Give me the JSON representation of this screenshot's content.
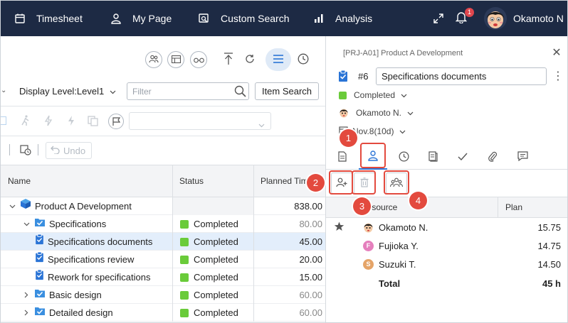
{
  "nav": {
    "items": [
      {
        "label": "Timesheet",
        "icon": "calendar-icon"
      },
      {
        "label": "My Page",
        "icon": "person-icon"
      },
      {
        "label": "Custom Search",
        "icon": "search-screen-icon"
      },
      {
        "label": "Analysis",
        "icon": "bar-chart-icon"
      }
    ],
    "notification_count": "1",
    "user_name": "Okamoto N"
  },
  "left": {
    "display_level": "Display Level:Level1",
    "filter_placeholder": "Filter",
    "item_search_label": "Item Search",
    "undo_label": "Undo",
    "columns": {
      "name": "Name",
      "status": "Status",
      "planned": "Planned Tim"
    },
    "rows": [
      {
        "name": "Product A Development",
        "status": "",
        "planned": "838.00",
        "expander": "expanded",
        "kind": "project"
      },
      {
        "name": "Specifications",
        "status": "Completed",
        "planned": "80.00",
        "expander": "expanded",
        "kind": "folder"
      },
      {
        "name": "Specifications documents",
        "status": "Completed",
        "planned": "45.00",
        "expander": "none",
        "kind": "task",
        "selected": true
      },
      {
        "name": "Specifications review",
        "status": "Completed",
        "planned": "20.00",
        "expander": "none",
        "kind": "task"
      },
      {
        "name": "Rework for specifications",
        "status": "Completed",
        "planned": "15.00",
        "expander": "none",
        "kind": "task"
      },
      {
        "name": "Basic design",
        "status": "Completed",
        "planned": "60.00",
        "expander": "collapsed",
        "kind": "folder"
      },
      {
        "name": "Detailed design",
        "status": "Completed",
        "planned": "60.00",
        "expander": "collapsed",
        "kind": "folder"
      }
    ],
    "status_color": "#6acb3a"
  },
  "detail": {
    "breadcrumb": "[PRJ-A01] Product A Development",
    "task_number": "#6",
    "task_title": "Specifications documents",
    "status": "Completed",
    "assignee": "Okamoto N.",
    "due": "Nov.8(10d)",
    "resource_header": "Resource",
    "plan_header": "Plan",
    "resources": [
      {
        "name": "Okamoto N.",
        "plan": "15.75",
        "avatar": "face",
        "starred": true
      },
      {
        "name": "Fujioka Y.",
        "plan": "14.75",
        "avatar": "F",
        "avatar_color": "#e57fbd",
        "starred": false
      },
      {
        "name": "Suzuki T.",
        "plan": "14.50",
        "avatar": "S",
        "avatar_color": "#e5a468",
        "starred": false
      }
    ],
    "total_label": "Total",
    "total_value": "45 h"
  },
  "callouts": [
    "1",
    "2",
    "3",
    "4"
  ],
  "accent_color": "#2a74d6",
  "callout_color": "#e34a3e"
}
